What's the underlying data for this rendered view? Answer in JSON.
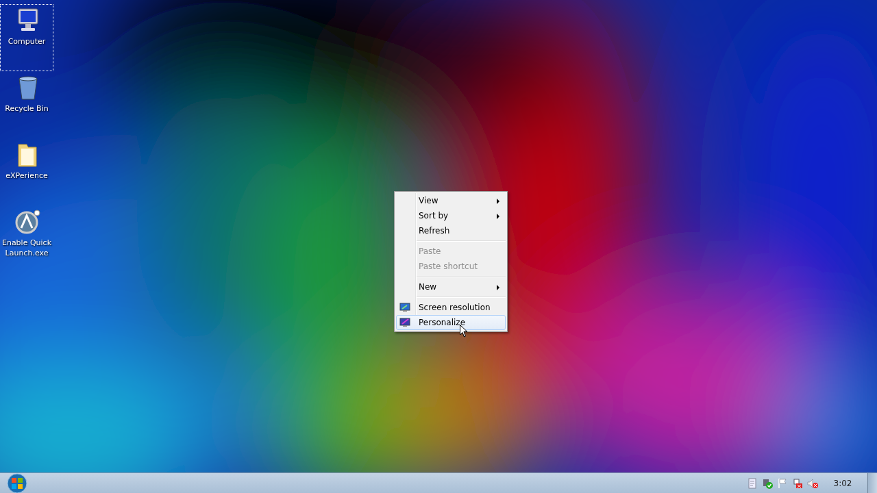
{
  "desktop_icons": [
    {
      "label": "Computer",
      "kind": "computer",
      "selected": true
    },
    {
      "label": "Recycle Bin",
      "kind": "trash",
      "selected": false
    },
    {
      "label": "eXPerience",
      "kind": "folder",
      "selected": false
    },
    {
      "label": "Enable Quick Launch.exe",
      "kind": "app",
      "selected": false
    }
  ],
  "context_menu": {
    "items": [
      {
        "kind": "item",
        "label": "View",
        "submenu": true,
        "disabled": false,
        "selected": false
      },
      {
        "kind": "item",
        "label": "Sort by",
        "submenu": true,
        "disabled": false,
        "selected": false
      },
      {
        "kind": "item",
        "label": "Refresh",
        "submenu": false,
        "disabled": false,
        "selected": false
      },
      {
        "kind": "separator"
      },
      {
        "kind": "item",
        "label": "Paste",
        "submenu": false,
        "disabled": true,
        "selected": false
      },
      {
        "kind": "item",
        "label": "Paste shortcut",
        "submenu": false,
        "disabled": true,
        "selected": false
      },
      {
        "kind": "separator"
      },
      {
        "kind": "item",
        "label": "New",
        "submenu": true,
        "disabled": false,
        "selected": false
      },
      {
        "kind": "separator"
      },
      {
        "kind": "display",
        "label": "Screen resolution",
        "submenu": false,
        "disabled": false,
        "selected": false
      },
      {
        "kind": "paint",
        "label": "Personalize",
        "submenu": false,
        "disabled": false,
        "selected": true
      }
    ]
  },
  "taskbar": {
    "tray_icons": [
      {
        "kind": "document"
      },
      {
        "kind": "check"
      },
      {
        "kind": "flag"
      },
      {
        "kind": "network"
      },
      {
        "kind": "speaker"
      }
    ],
    "clock": "3:02"
  }
}
